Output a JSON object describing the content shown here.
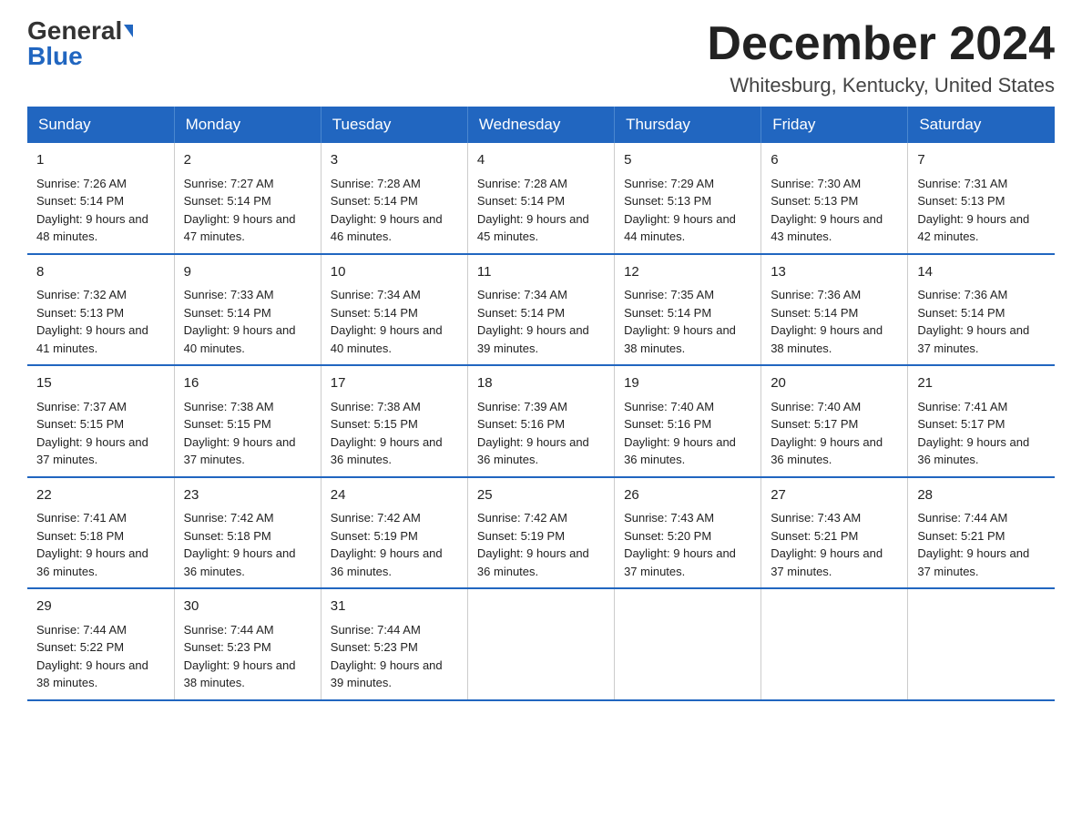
{
  "header": {
    "logo_general": "General",
    "logo_blue": "Blue",
    "title": "December 2024",
    "location": "Whitesburg, Kentucky, United States"
  },
  "days_of_week": [
    "Sunday",
    "Monday",
    "Tuesday",
    "Wednesday",
    "Thursday",
    "Friday",
    "Saturday"
  ],
  "weeks": [
    [
      {
        "day": "1",
        "sunrise": "7:26 AM",
        "sunset": "5:14 PM",
        "daylight": "9 hours and 48 minutes."
      },
      {
        "day": "2",
        "sunrise": "7:27 AM",
        "sunset": "5:14 PM",
        "daylight": "9 hours and 47 minutes."
      },
      {
        "day": "3",
        "sunrise": "7:28 AM",
        "sunset": "5:14 PM",
        "daylight": "9 hours and 46 minutes."
      },
      {
        "day": "4",
        "sunrise": "7:28 AM",
        "sunset": "5:14 PM",
        "daylight": "9 hours and 45 minutes."
      },
      {
        "day": "5",
        "sunrise": "7:29 AM",
        "sunset": "5:13 PM",
        "daylight": "9 hours and 44 minutes."
      },
      {
        "day": "6",
        "sunrise": "7:30 AM",
        "sunset": "5:13 PM",
        "daylight": "9 hours and 43 minutes."
      },
      {
        "day": "7",
        "sunrise": "7:31 AM",
        "sunset": "5:13 PM",
        "daylight": "9 hours and 42 minutes."
      }
    ],
    [
      {
        "day": "8",
        "sunrise": "7:32 AM",
        "sunset": "5:13 PM",
        "daylight": "9 hours and 41 minutes."
      },
      {
        "day": "9",
        "sunrise": "7:33 AM",
        "sunset": "5:14 PM",
        "daylight": "9 hours and 40 minutes."
      },
      {
        "day": "10",
        "sunrise": "7:34 AM",
        "sunset": "5:14 PM",
        "daylight": "9 hours and 40 minutes."
      },
      {
        "day": "11",
        "sunrise": "7:34 AM",
        "sunset": "5:14 PM",
        "daylight": "9 hours and 39 minutes."
      },
      {
        "day": "12",
        "sunrise": "7:35 AM",
        "sunset": "5:14 PM",
        "daylight": "9 hours and 38 minutes."
      },
      {
        "day": "13",
        "sunrise": "7:36 AM",
        "sunset": "5:14 PM",
        "daylight": "9 hours and 38 minutes."
      },
      {
        "day": "14",
        "sunrise": "7:36 AM",
        "sunset": "5:14 PM",
        "daylight": "9 hours and 37 minutes."
      }
    ],
    [
      {
        "day": "15",
        "sunrise": "7:37 AM",
        "sunset": "5:15 PM",
        "daylight": "9 hours and 37 minutes."
      },
      {
        "day": "16",
        "sunrise": "7:38 AM",
        "sunset": "5:15 PM",
        "daylight": "9 hours and 37 minutes."
      },
      {
        "day": "17",
        "sunrise": "7:38 AM",
        "sunset": "5:15 PM",
        "daylight": "9 hours and 36 minutes."
      },
      {
        "day": "18",
        "sunrise": "7:39 AM",
        "sunset": "5:16 PM",
        "daylight": "9 hours and 36 minutes."
      },
      {
        "day": "19",
        "sunrise": "7:40 AM",
        "sunset": "5:16 PM",
        "daylight": "9 hours and 36 minutes."
      },
      {
        "day": "20",
        "sunrise": "7:40 AM",
        "sunset": "5:17 PM",
        "daylight": "9 hours and 36 minutes."
      },
      {
        "day": "21",
        "sunrise": "7:41 AM",
        "sunset": "5:17 PM",
        "daylight": "9 hours and 36 minutes."
      }
    ],
    [
      {
        "day": "22",
        "sunrise": "7:41 AM",
        "sunset": "5:18 PM",
        "daylight": "9 hours and 36 minutes."
      },
      {
        "day": "23",
        "sunrise": "7:42 AM",
        "sunset": "5:18 PM",
        "daylight": "9 hours and 36 minutes."
      },
      {
        "day": "24",
        "sunrise": "7:42 AM",
        "sunset": "5:19 PM",
        "daylight": "9 hours and 36 minutes."
      },
      {
        "day": "25",
        "sunrise": "7:42 AM",
        "sunset": "5:19 PM",
        "daylight": "9 hours and 36 minutes."
      },
      {
        "day": "26",
        "sunrise": "7:43 AM",
        "sunset": "5:20 PM",
        "daylight": "9 hours and 37 minutes."
      },
      {
        "day": "27",
        "sunrise": "7:43 AM",
        "sunset": "5:21 PM",
        "daylight": "9 hours and 37 minutes."
      },
      {
        "day": "28",
        "sunrise": "7:44 AM",
        "sunset": "5:21 PM",
        "daylight": "9 hours and 37 minutes."
      }
    ],
    [
      {
        "day": "29",
        "sunrise": "7:44 AM",
        "sunset": "5:22 PM",
        "daylight": "9 hours and 38 minutes."
      },
      {
        "day": "30",
        "sunrise": "7:44 AM",
        "sunset": "5:23 PM",
        "daylight": "9 hours and 38 minutes."
      },
      {
        "day": "31",
        "sunrise": "7:44 AM",
        "sunset": "5:23 PM",
        "daylight": "9 hours and 39 minutes."
      },
      null,
      null,
      null,
      null
    ]
  ],
  "labels": {
    "sunrise": "Sunrise:",
    "sunset": "Sunset:",
    "daylight": "Daylight:"
  }
}
